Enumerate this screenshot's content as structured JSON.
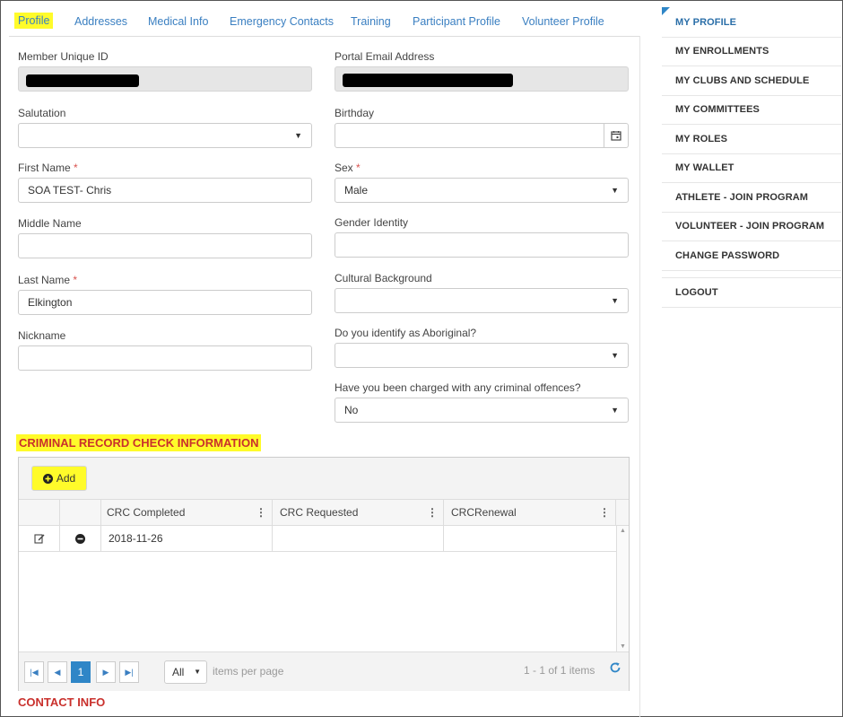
{
  "tabs": [
    "Profile",
    "Addresses",
    "Medical Info",
    "Emergency Contacts",
    "Training",
    "Participant Profile",
    "Volunteer Profile"
  ],
  "form": {
    "member_id_label": "Member Unique ID",
    "portal_email_label": "Portal Email Address",
    "salutation_label": "Salutation",
    "salutation_value": "",
    "birthday_label": "Birthday",
    "birthday_value": "",
    "first_name_label": "First Name",
    "first_name_value": "SOA TEST- Chris",
    "sex_label": "Sex",
    "sex_value": "Male",
    "middle_name_label": "Middle Name",
    "middle_name_value": "",
    "gender_identity_label": "Gender Identity",
    "gender_identity_value": "",
    "last_name_label": "Last Name",
    "last_name_value": "Elkington",
    "cultural_label": "Cultural Background",
    "cultural_value": "",
    "nickname_label": "Nickname",
    "nickname_value": "",
    "aboriginal_label": "Do you identify as Aboriginal?",
    "aboriginal_value": "",
    "criminal_label": "Have you been charged with any criminal offences?",
    "criminal_value": "No",
    "required_marker": "*"
  },
  "crc": {
    "section_title": "CRIMINAL RECORD CHECK INFORMATION",
    "add_label": "Add",
    "columns": [
      "CRC Completed",
      "CRC Requested",
      "CRCRenewal"
    ],
    "rows": [
      {
        "completed": "2018-11-26",
        "requested": "",
        "renewal": ""
      }
    ],
    "pager": {
      "current_page": "1",
      "page_size": "All",
      "items_per_page_label": "items per page",
      "summary": "1 - 1 of 1 items"
    }
  },
  "contact_title": "CONTACT INFO",
  "sidebar": {
    "items": [
      "MY PROFILE",
      "MY ENROLLMENTS",
      "MY CLUBS AND SCHEDULE",
      "MY COMMITTEES",
      "MY ROLES",
      "MY WALLET",
      "ATHLETE - JOIN PROGRAM",
      "VOLUNTEER - JOIN PROGRAM",
      "CHANGE PASSWORD"
    ],
    "logout": "LOGOUT"
  },
  "colors": {
    "accent": "#2f86c7",
    "highlight": "#fffb2a",
    "section_red": "#c9302c",
    "tab_blue": "#3a7fc1"
  }
}
